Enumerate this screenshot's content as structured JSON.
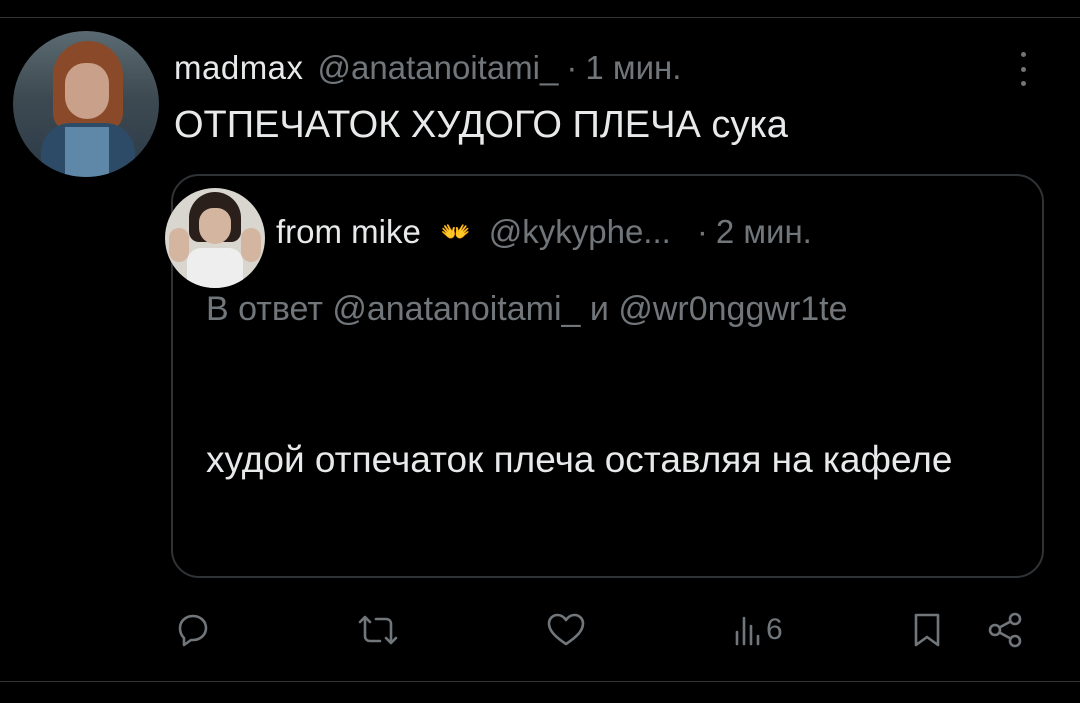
{
  "tweet": {
    "author_name": "madmax",
    "author_handle": "@anatanoitami_",
    "separator": "·",
    "time": "1 мин.",
    "text": "ОТПЕЧАТОК ХУДОГО ПЛЕЧА сука"
  },
  "quote": {
    "author_name": "from mike",
    "author_emoji": "👐",
    "author_handle": "@kykyphe...",
    "separator": "·",
    "time": "2 мин.",
    "reply_to": "В ответ @anatanoitami_ и @wr0nggwr1te",
    "text": "худой отпечаток плеча оставляя на кафеле"
  },
  "actions": {
    "views_count": "6"
  },
  "icons": {
    "reply": "reply-icon",
    "retweet": "retweet-icon",
    "like": "heart-icon",
    "views": "views-icon",
    "bookmark": "bookmark-icon",
    "share": "share-icon",
    "more": "more-icon"
  },
  "colors": {
    "background": "#000000",
    "text_primary": "#e7e9ea",
    "text_secondary": "#71767b",
    "border": "#2f3336"
  }
}
